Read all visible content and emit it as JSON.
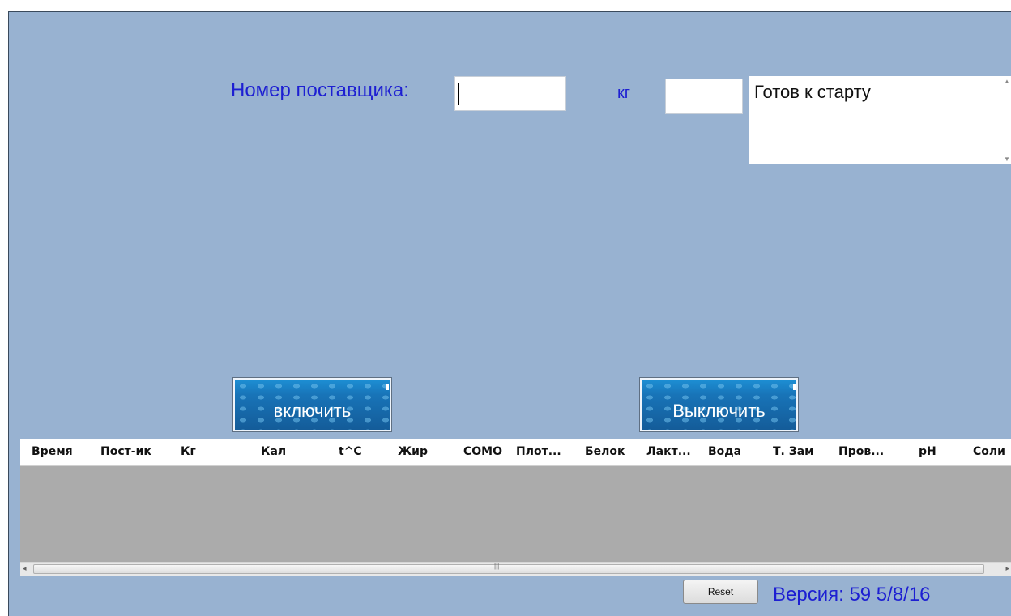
{
  "form": {
    "supplier_label": "Номер поставщика:",
    "supplier_value": "",
    "kg_label": "кг",
    "kg_value": "",
    "status_text": "Готов к старту"
  },
  "buttons": {
    "start_label": "включить",
    "stop_label": "Выключить",
    "reset_label": "Reset"
  },
  "table": {
    "columns": [
      "Время",
      "Пост-ик",
      "Кг",
      "Кал",
      "t^C",
      "Жир",
      "СОМО",
      "Плот...",
      "Белок",
      "Лакт...",
      "Вода",
      "Т. Зам",
      "Пров...",
      "pH",
      "Соли"
    ],
    "rows": []
  },
  "footer": {
    "version_text": "Версия: 59  5/8/16"
  },
  "colors": {
    "background": "#98b2d1",
    "label_blue": "#1d1fd2",
    "button_blue": "#1874b8",
    "grid_empty": "#ababab"
  }
}
